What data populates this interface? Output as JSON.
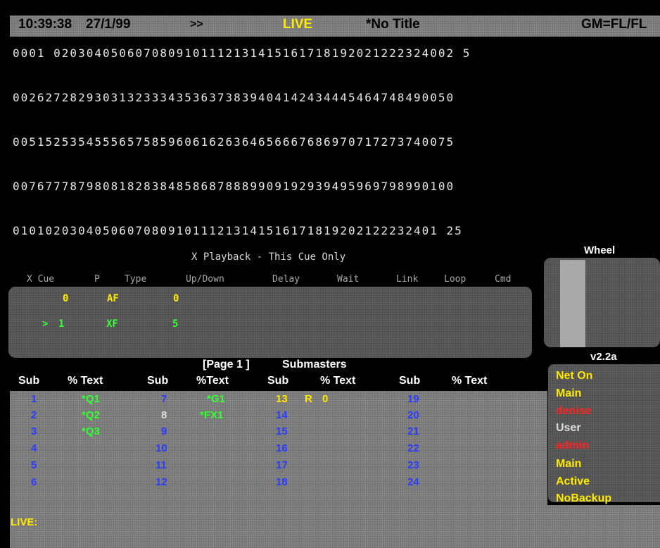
{
  "header": {
    "time": "10:39:38",
    "date": "27/1/99",
    "arrows": ">>",
    "mode": "LIVE",
    "title": "*No Title",
    "gm": "GM=FL/FL"
  },
  "channels": {
    "rows": [
      "0001  0203040506070809101112131415161718192021222324002 5",
      "002627282930313233343536373839404142434445464748490050",
      "005152535455565758596061626364656667686970717273740075",
      "007677787980818283848586878889909192939495969798990100",
      "0101020304050607080910111213141516171819202122232401 25"
    ]
  },
  "x_playback": {
    "title": "X Playback - This Cue Only",
    "headers": [
      "X Cue",
      "P",
      "Type",
      "Up/Down",
      "Delay",
      "Wait",
      "Link",
      "Loop",
      "Cmd"
    ],
    "rows": [
      {
        "marker": "",
        "cue": "0",
        "type": "AF",
        "updown": "0"
      },
      {
        "marker": ">",
        "cue": "1",
        "type": "XF",
        "updown": "5"
      }
    ],
    "colors": {
      "row0": "#ffea00",
      "row1": "#33ff33"
    }
  },
  "wheel": {
    "title": "Wheel",
    "version": "v2.2a"
  },
  "status": {
    "items": [
      {
        "text": "Net On",
        "color": "#ffea00"
      },
      {
        "text": "Main",
        "color": "#ffea00"
      },
      {
        "text": "denise",
        "color": "#ff2222"
      },
      {
        "text": "User",
        "color": "#dddddd"
      },
      {
        "text": "admin",
        "color": "#ff2222"
      },
      {
        "text": "Main",
        "color": "#ffea00"
      },
      {
        "text": "Active",
        "color": "#ffea00"
      },
      {
        "text": "NoBackup",
        "color": "#ffea00"
      }
    ]
  },
  "submasters": {
    "page": "[Page 1 ]",
    "title": "Submasters",
    "headers": [
      "Sub",
      "% Text",
      "Sub",
      "%Text",
      "Sub",
      "% Text",
      "Sub",
      "% Text"
    ],
    "col1": [
      {
        "sub": "1",
        "text": "*Q1"
      },
      {
        "sub": "2",
        "text": "*Q2"
      },
      {
        "sub": "3",
        "text": "*Q3"
      },
      {
        "sub": "4",
        "text": ""
      },
      {
        "sub": "5",
        "text": ""
      },
      {
        "sub": "6",
        "text": ""
      }
    ],
    "col2": [
      {
        "sub": "7",
        "text": "*G1"
      },
      {
        "sub": "8",
        "text": "*FX1"
      },
      {
        "sub": "9",
        "text": ""
      },
      {
        "sub": "10",
        "text": ""
      },
      {
        "sub": "11",
        "text": ""
      },
      {
        "sub": "12",
        "text": ""
      }
    ],
    "col3": [
      {
        "sub": "13",
        "flag": "R",
        "pct": "0"
      },
      {
        "sub": "14"
      },
      {
        "sub": "15"
      },
      {
        "sub": "16"
      },
      {
        "sub": "17"
      },
      {
        "sub": "18"
      }
    ],
    "col4": [
      {
        "sub": "19"
      },
      {
        "sub": "20"
      },
      {
        "sub": "21"
      },
      {
        "sub": "22"
      },
      {
        "sub": "23"
      },
      {
        "sub": "24"
      }
    ],
    "colors": {
      "sub": "#2a3cff",
      "sub_inactive": "#e0e0e0",
      "sub_active": "#ffea00",
      "text": "#33ff33"
    }
  },
  "command_line": {
    "prompt": "LIVE:"
  },
  "colors": {
    "background": "#000000",
    "panel": "#7a7a7a",
    "live": "#ffea00",
    "header_text": "#000000"
  }
}
